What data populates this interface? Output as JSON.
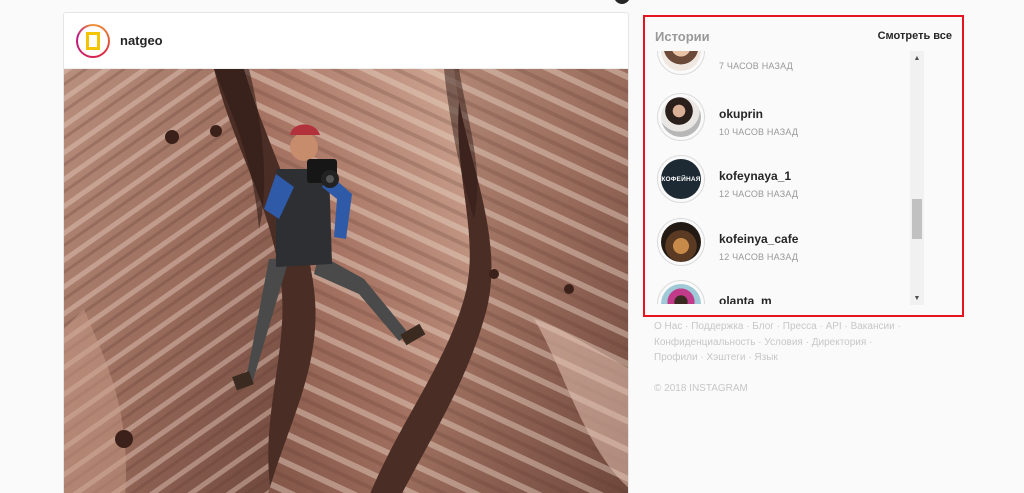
{
  "post": {
    "username": "natgeo",
    "avatar_icon": "national-geographic-logo"
  },
  "stories": {
    "title": "Истории",
    "see_all": "Смотреть все",
    "items": [
      {
        "name": "",
        "time": "7 ЧАСОВ НАЗАД"
      },
      {
        "name": "okuprin",
        "time": "10 ЧАСОВ НАЗАД"
      },
      {
        "name": "kofeynaya_1",
        "time": "12 ЧАСОВ НАЗАД",
        "badge": "КОФЕЙНАЯ"
      },
      {
        "name": "kofeinya_cafe",
        "time": "12 ЧАСОВ НАЗАД"
      },
      {
        "name": "olanta_m",
        "time": ""
      }
    ]
  },
  "footer": {
    "links": [
      "О Нас",
      "Поддержка",
      "Блог",
      "Пресса",
      "API",
      "Вакансии",
      "Конфиденциальность",
      "Условия",
      "Директория",
      "Профили",
      "Хэштеги",
      "Язык"
    ],
    "copyright": "© 2018 INSTAGRAM"
  },
  "colors": {
    "highlight_border": "#e5141e",
    "muted_text": "#999999",
    "footer_text": "#c7c7c7"
  }
}
